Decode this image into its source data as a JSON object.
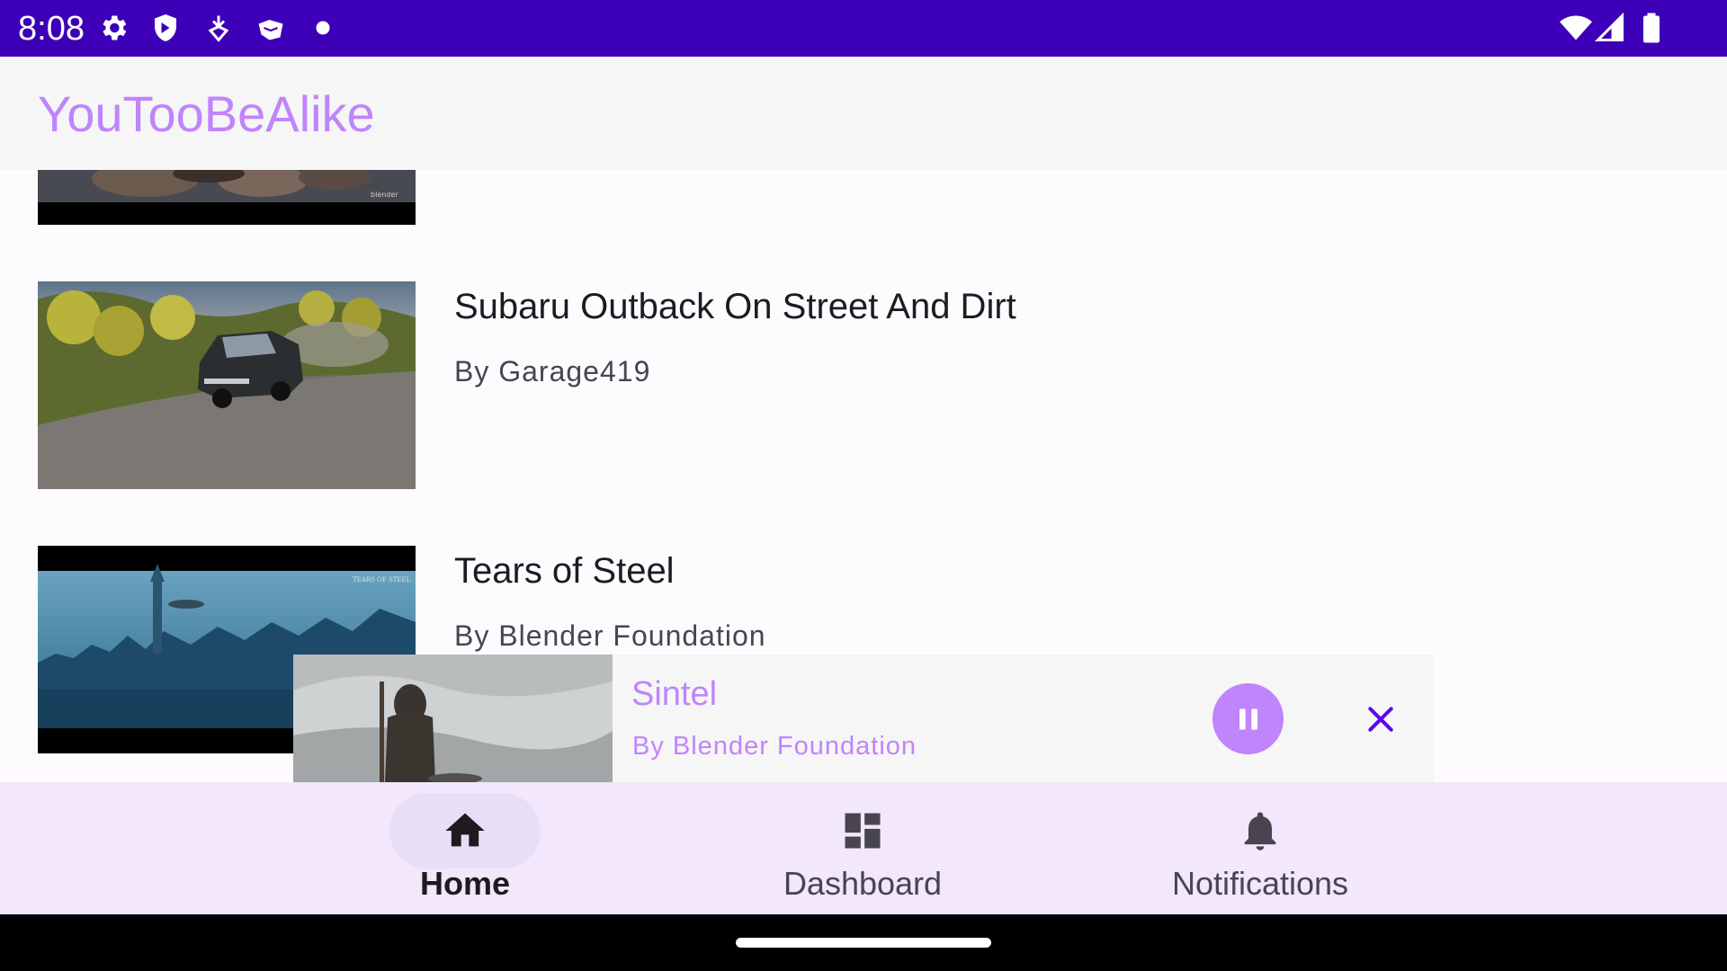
{
  "status_bar": {
    "time": "8:08",
    "left_icons": [
      "gear-icon",
      "shield-icon",
      "download-location-icon",
      "ebook-icon",
      "dot-icon"
    ],
    "right_icons": [
      "wifi-icon",
      "cell-signal-icon",
      "battery-icon"
    ],
    "background": "#3d00b8"
  },
  "app_bar": {
    "title": "YouTooBeAlike",
    "title_color": "#c084fc"
  },
  "videos": [
    {
      "title": "",
      "author": "",
      "thumbnail": "blender-crowd-thumbnail"
    },
    {
      "title": "Subaru Outback On Street And Dirt",
      "author": "By Garage419",
      "thumbnail": "subaru-outback-thumbnail"
    },
    {
      "title": "Tears of Steel",
      "author": "By Blender Foundation",
      "thumbnail": "tears-of-steel-thumbnail"
    }
  ],
  "mini_player": {
    "title": "Sintel",
    "author": "By Blender Foundation",
    "state": "playing",
    "accent": "#c084fc",
    "close_color": "#6200ee"
  },
  "bottom_nav": {
    "items": [
      {
        "label": "Home",
        "icon": "home-icon",
        "active": true
      },
      {
        "label": "Dashboard",
        "icon": "dashboard-icon",
        "active": false
      },
      {
        "label": "Notifications",
        "icon": "bell-icon",
        "active": false
      }
    ]
  }
}
